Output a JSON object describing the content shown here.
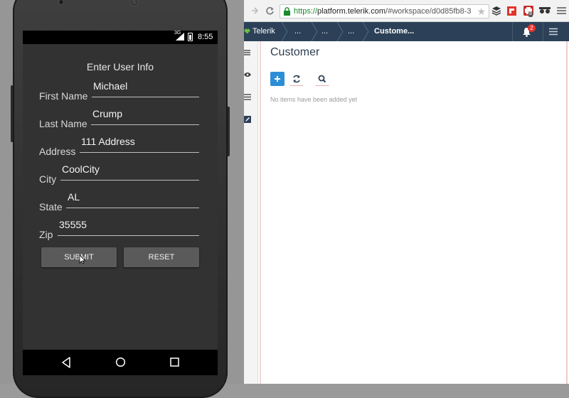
{
  "device": {
    "status": {
      "time": "8:55",
      "network": "3G"
    },
    "form": {
      "title": "Enter User Info",
      "fields": [
        {
          "label": "First Name",
          "value": "Michael"
        },
        {
          "label": "Last Name",
          "value": "Crump"
        },
        {
          "label": "Address",
          "value": "111 Address"
        },
        {
          "label": "City",
          "value": "CoolCity"
        },
        {
          "label": "State",
          "value": "AL"
        },
        {
          "label": "Zip",
          "value": "35555"
        }
      ],
      "submit_label": "SUBMIT",
      "reset_label": "RESET"
    },
    "navbar": {
      "icons": [
        "back-icon",
        "home-icon",
        "recents-icon"
      ]
    }
  },
  "browser": {
    "url_secure": "https://",
    "url_host": "platform.telerik.com",
    "url_rest": "/#workspace/d0d85fb8-3...",
    "extension_badge": "8",
    "notification_count": "2",
    "breadcrumbs": [
      "Telerik",
      "...",
      "...",
      "...",
      "Custome..."
    ],
    "page_title": "Customer",
    "empty_message": "No items have been added yet",
    "colors": {
      "nav_bg": "#2c4158",
      "accent": "#2d8ed6",
      "telerik_green": "#6cbf45"
    }
  }
}
